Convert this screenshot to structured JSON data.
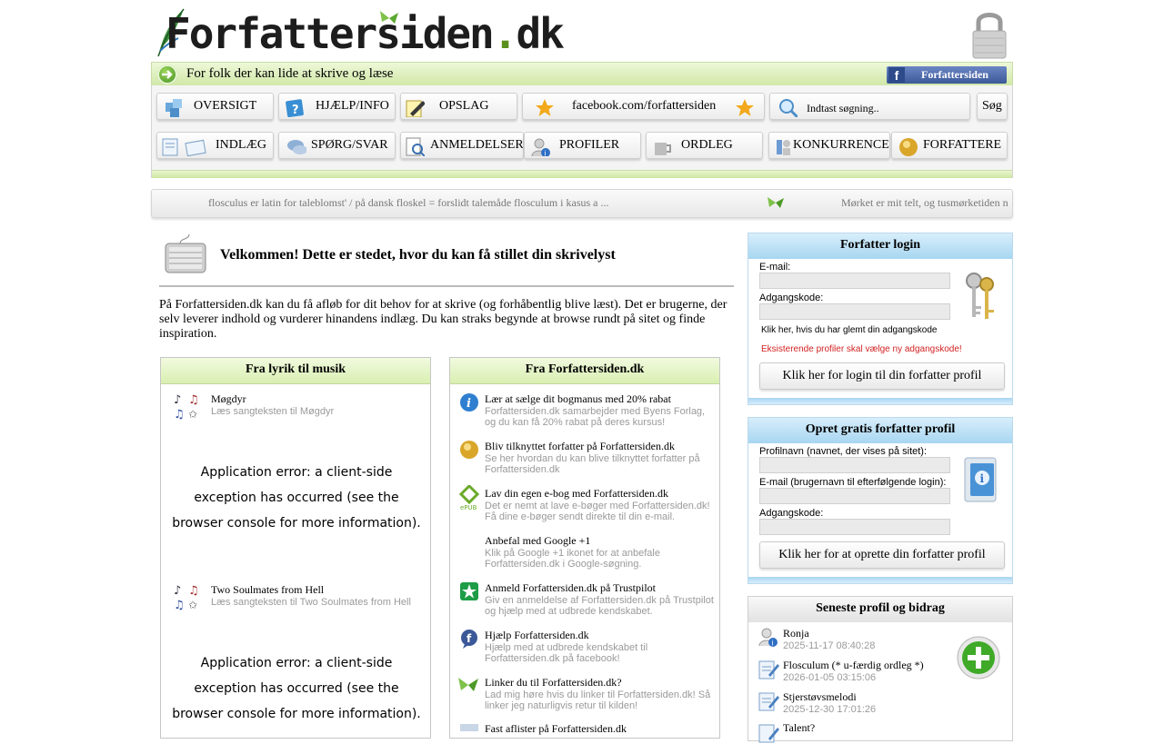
{
  "logo": {
    "text_a": "Forfatteriden",
    "text_main": "Forfattersiden",
    "dot": ".",
    "tld": "dk"
  },
  "tagline": "For folk der kan lide at skrive og læse",
  "facebook_button": {
    "icon": "f",
    "label": "Forfattersiden"
  },
  "menu": {
    "oversigt": "OVERSIGT",
    "hjaelp": "HJÆLP/INFO",
    "opslag": "OPSLAG",
    "facebook_link": "facebook.com/forfattersiden",
    "search_placeholder": "Indtast søgning..",
    "search_button": "Søg",
    "indlaeg": "INDLÆG",
    "spoerg": "SPØRG/SVAR",
    "anmeldelser": "ANMELDELSER",
    "profiler": "PROFILER",
    "ordleg": "ORDLEG",
    "konkurrencer": "KONKURRENCE",
    "forfattere": "FORFATTERE"
  },
  "ticker": {
    "text1": "flosculus er latin for taleblomst' / på dansk floskel = forslidt talemåde flosculum i kasus a ...",
    "text2": "Mørket er mit telt, og tusmørketiden n"
  },
  "welcome": {
    "title": "Velkommen! Dette er stedet, hvor du kan få stillet din skrivelyst",
    "intro": "På Forfattersiden.dk kan du få afløb for dit behov for at skrive (og forhåbentlig blive læst). Det er brugerne, der selv leverer indhold og vurderer hinandens indlæg. Du kan straks begynde at browse rundt på sitet og finde inspiration."
  },
  "lyrik": {
    "title": "Fra lyrik til musik",
    "items": [
      {
        "title": "Møgdyr",
        "sub": "Læs sangteksten til Møgdyr"
      },
      {
        "title": "Two Soulmates from Hell",
        "sub": "Læs sangteksten til Two Soulmates from Hell"
      }
    ],
    "error": "Application error: a client-side exception has occurred (see the browser console for more information)."
  },
  "fra": {
    "title": "Fra Forfattersiden.dk",
    "items": [
      {
        "title": "Lær at sælge dit bogmanus med 20% rabat",
        "sub": "Forfattersiden.dk samarbejder med Byens Forlag, og du kan få 20% rabat på deres kursus!"
      },
      {
        "title": "Bliv tilknyttet forfatter på Forfattersiden.dk",
        "sub": "Se her hvordan du kan blive tilknyttet forfatter på Forfattersiden.dk"
      },
      {
        "title": "Lav din egen e-bog med Forfattersiden.dk",
        "sub": "Det er nemt at lave e-bøger med Forfattersiden.dk! Få dine e-bøger sendt direkte til din e-mail."
      },
      {
        "title": "Anbefal med Google +1",
        "sub": "Klik på Google +1 ikonet for at anbefale Forfattersiden.dk i Google-søgning."
      },
      {
        "title": "Anmeld Forfattersiden.dk på Trustpilot",
        "sub": "Giv en anmeldelse af Forfattersiden.dk på Trustpilot og hjælp med at udbrede kendskabet."
      },
      {
        "title": "Hjælp Forfattersiden.dk",
        "sub": "Hjælp med at udbrede kendskabet til Forfattersiden.dk på facebook!"
      },
      {
        "title": "Linker du til Forfattersiden.dk?",
        "sub": "Lad mig høre hvis du linker til Forfattersiden.dk! Så linker jeg naturligvis retur til kilden!"
      },
      {
        "title": "Fast aflister på Forfattersiden.dk",
        "sub": ""
      }
    ]
  },
  "login": {
    "title": "Forfatter login",
    "email_label": "E-mail:",
    "password_label": "Adgangskode:",
    "forgot": "Klik her, hvis du har glemt din adgangskode",
    "notice": "Eksisterende profiler skal vælge ny adgangskode!",
    "button": "Klik her for login til din forfatter profil"
  },
  "signup": {
    "title": "Opret gratis forfatter profil",
    "profile_label": "Profilnavn (navnet, der vises på sitet):",
    "email_label": "E-mail (brugernavn til efterfølgende login):",
    "password_label": "Adgangskode:",
    "button": "Klik her for at oprette din forfatter profil"
  },
  "latest": {
    "title": "Seneste profil og bidrag",
    "items": [
      {
        "title": "Ronja",
        "date": "2025-11-17 08:40:28"
      },
      {
        "title": "Flosculum (* u-færdig ordleg *)",
        "date": "2026-01-05 03:15:06"
      },
      {
        "title": "Stjerstøvsmelodi",
        "date": "2025-12-30 17:01:26"
      },
      {
        "title": "Talent?",
        "date": ""
      }
    ]
  },
  "colors": {
    "green_accent": "#5c8f1c",
    "blue_header": "#a7d6f1",
    "green_header": "#d9efb1",
    "notice_red": "#d22222",
    "facebook_blue": "#3b5898"
  }
}
